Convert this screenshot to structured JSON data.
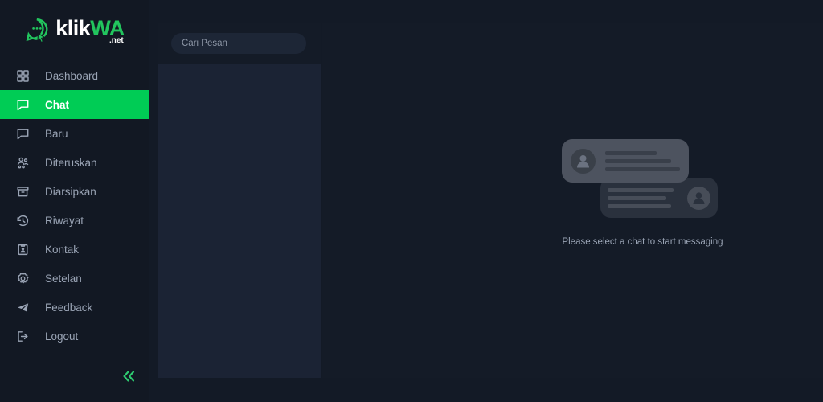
{
  "brand": {
    "name_part1": "klik",
    "name_part2": "WA",
    "suffix": ".net",
    "logo_icon": "chat-bubble-cursor-icon",
    "accent_color": "#22c55e"
  },
  "sidebar": {
    "active_color": "#00cc55",
    "items": [
      {
        "label": "Dashboard",
        "icon": "grid-icon",
        "active": false
      },
      {
        "label": "Chat",
        "icon": "chat-bubble-icon",
        "active": true
      },
      {
        "label": "Baru",
        "icon": "message-icon",
        "active": false
      },
      {
        "label": "Diteruskan",
        "icon": "users-icon",
        "active": false
      },
      {
        "label": "Diarsipkan",
        "icon": "archive-icon",
        "active": false
      },
      {
        "label": "Riwayat",
        "icon": "history-icon",
        "active": false
      },
      {
        "label": "Kontak",
        "icon": "contact-card-icon",
        "active": false
      },
      {
        "label": "Setelan",
        "icon": "gear-icon",
        "active": false
      },
      {
        "label": "Feedback",
        "icon": "paper-plane-icon",
        "active": false
      },
      {
        "label": "Logout",
        "icon": "logout-icon",
        "active": false
      }
    ],
    "collapse": {
      "icon": "chevron-double-left-icon",
      "color": "#2ecc71"
    }
  },
  "chat_list": {
    "search": {
      "placeholder": "Cari Pesan",
      "value": ""
    },
    "items": []
  },
  "chat_pane": {
    "empty_state": {
      "message": "Please select a chat to start messaging",
      "illustration": "chat-bubbles-placeholder"
    }
  }
}
